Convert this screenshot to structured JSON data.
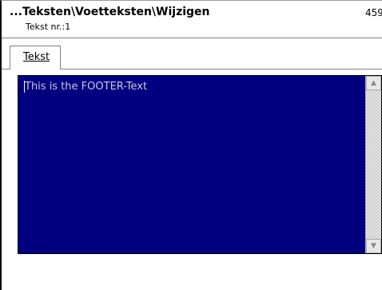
{
  "window": {
    "title": "...Teksten\\Voetteksten\\Wijzigen",
    "subtitle": "Tekst nr.:1",
    "corner_number": "459"
  },
  "tabs": [
    {
      "label": "Tekst",
      "active": true
    }
  ],
  "editor": {
    "value": "This is the FOOTER-Text",
    "background_color": "#000080",
    "text_color": "#c9c9d8"
  },
  "scrollbar": {
    "up_icon": "triangle-up-icon",
    "down_icon": "triangle-down-icon"
  }
}
